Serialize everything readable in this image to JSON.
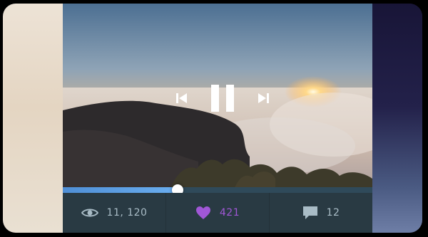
{
  "player": {
    "progress_fraction": 0.37,
    "state": "playing"
  },
  "controls": {
    "prev_icon": "skip-back-icon",
    "pause_icon": "pause-icon",
    "next_icon": "skip-forward-icon"
  },
  "stats": {
    "views": {
      "icon": "eye-icon",
      "value": "11, 120"
    },
    "likes": {
      "icon": "heart-icon",
      "value": "421"
    },
    "comments": {
      "icon": "comment-icon",
      "value": "12"
    }
  },
  "colors": {
    "accent": "#5a9ee6",
    "heart": "#a057d6",
    "stat_text": "#a9bcc6",
    "footer_bg": "#293a43"
  }
}
